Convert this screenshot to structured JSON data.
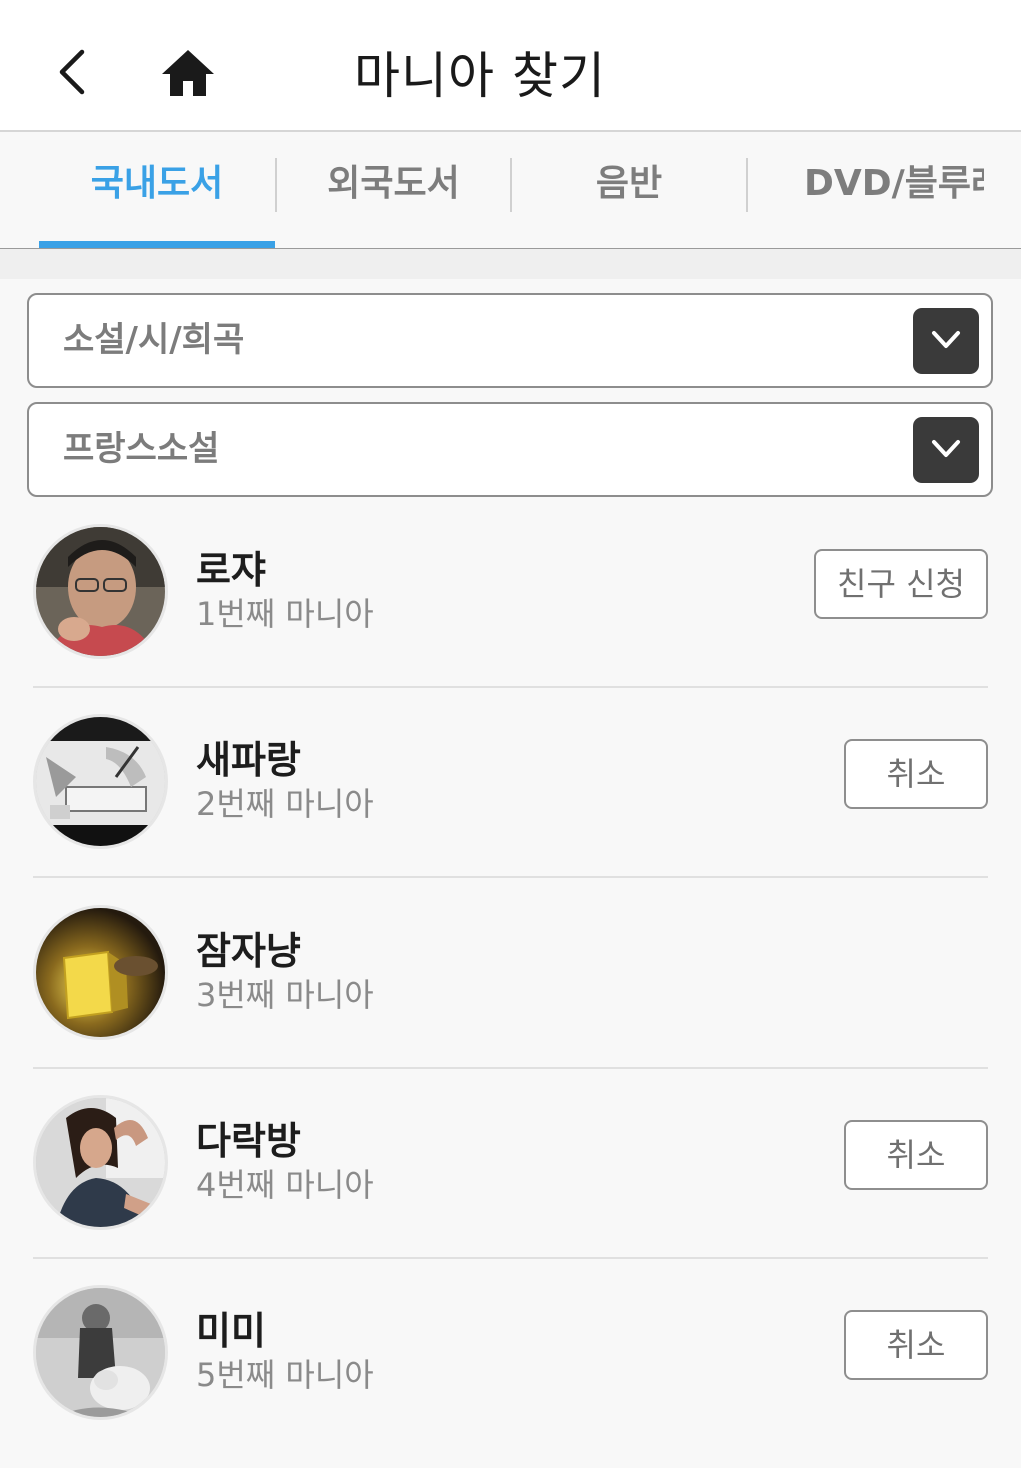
{
  "header": {
    "title": "마니아 찾기",
    "back_icon": "chevron-left-icon",
    "home_icon": "home-icon"
  },
  "tabs": [
    {
      "label": "국내도서",
      "active": true
    },
    {
      "label": "외국도서",
      "active": false
    },
    {
      "label": "음반",
      "active": false
    },
    {
      "label": "DVD/블루레이",
      "active": false
    }
  ],
  "filters": {
    "category": "소설/시/희곡",
    "subcategory": "프랑스소설",
    "dropdown_icon": "chevron-down-icon"
  },
  "users": [
    {
      "name": "로쟈",
      "rank": "1번째 마니아",
      "action": "친구 신청"
    },
    {
      "name": "새파랑",
      "rank": "2번째 마니아",
      "action": "취소"
    },
    {
      "name": "잠자냥",
      "rank": "3번째 마니아",
      "action": null
    },
    {
      "name": "다락방",
      "rank": "4번째 마니아",
      "action": "취소"
    },
    {
      "name": "미미",
      "rank": "5번째 마니아",
      "action": "취소"
    }
  ],
  "colors": {
    "accent": "#3aa1e6",
    "dropdown_button": "#3a3a3a",
    "background": "#f8f8f8"
  }
}
